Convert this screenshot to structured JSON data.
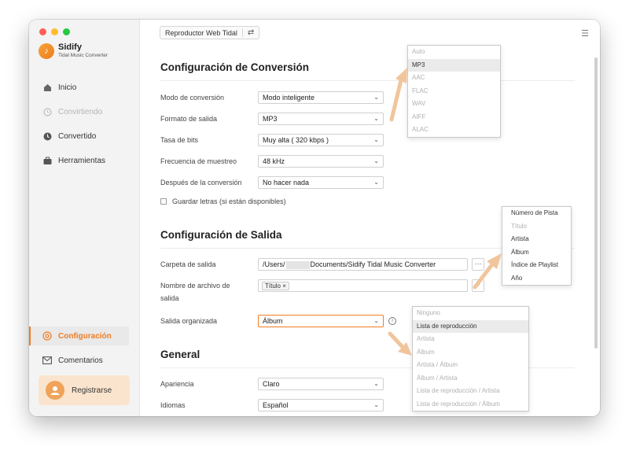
{
  "app": {
    "name": "Sidify",
    "subtitle": "Tidal Music Converter"
  },
  "sidebar": {
    "items": [
      {
        "label": "Inicio",
        "icon": "home-icon",
        "state": "normal"
      },
      {
        "label": "Convirtiendo",
        "icon": "sync-icon",
        "state": "disabled"
      },
      {
        "label": "Convertido",
        "icon": "clock-icon",
        "state": "normal"
      },
      {
        "label": "Herramientas",
        "icon": "toolbox-icon",
        "state": "normal"
      }
    ],
    "bottom": [
      {
        "label": "Configuración",
        "icon": "gear-icon",
        "state": "active"
      },
      {
        "label": "Comentarios",
        "icon": "mail-icon",
        "state": "normal"
      }
    ],
    "register_label": "Registrarse"
  },
  "topbar": {
    "source_label": "Reproductor Web Tidal",
    "swap_icon": "⇄",
    "menu_icon": "☰"
  },
  "conversion": {
    "title": "Configuración de Conversión",
    "mode_label": "Modo de conversión",
    "mode_value": "Modo inteligente",
    "format_label": "Formato de salida",
    "format_value": "MP3",
    "bitrate_label": "Tasa de bits",
    "bitrate_value": "Muy alta ( 320 kbps )",
    "sample_label": "Frecuencia de muestreo",
    "sample_value": "48 kHz",
    "after_label": "Después de la conversión",
    "after_value": "No hacer nada",
    "lyrics_label": "Guardar letras (si están disponibles)"
  },
  "output": {
    "title": "Configuración de Salida",
    "folder_label": "Carpeta de salida",
    "folder_prefix": "/Users/",
    "folder_suffix": "Documents/Sidify Tidal Music Converter",
    "folder_button": "···",
    "filename_label_1": "Nombre de archivo de",
    "filename_label_2": "salida",
    "filename_tag": "Título",
    "filename_tag_remove": "×",
    "add_button": "+",
    "organized_label": "Salida organizada",
    "organized_value": "Álbum",
    "info_icon": "i"
  },
  "general": {
    "title": "General",
    "appearance_label": "Apariencia",
    "appearance_value": "Claro",
    "language_label": "Idiomas",
    "language_value": "Español"
  },
  "format_dropdown": [
    "Auto",
    "MP3",
    "AAC",
    "FLAC",
    "WAV",
    "AIFF",
    "ALAC"
  ],
  "filename_dropdown": [
    "Número de Pista",
    "Título",
    "Artista",
    "Álbum",
    "Índice de Playlist",
    "Año"
  ],
  "organized_dropdown": [
    "Ninguno",
    "Lista de reproducción",
    "Artista",
    "Álbum",
    "Artista / Álbum",
    "Álbum / Artista",
    "Lista de reproducción / Artista",
    "Lista de reproducción / Álbum"
  ],
  "colors": {
    "accent": "#ef7c24",
    "arrow": "#f1c59c",
    "sidebar_bg": "#f3f3f3"
  },
  "chevron": "⌄"
}
